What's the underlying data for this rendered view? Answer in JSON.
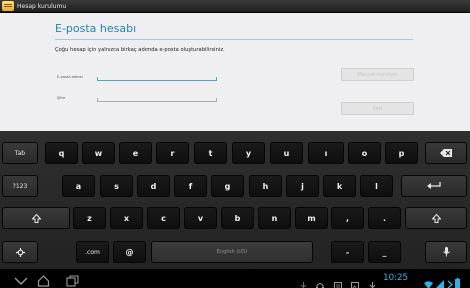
{
  "app": {
    "title": "Hesap kurulumu",
    "icon": "account-setup-icon"
  },
  "form": {
    "heading": "E-posta hesabı",
    "description": "Çoğu hesap için yalnızca birkaç adımda e-posta oluşturabilirsiniz.",
    "email_label": "E-posta adresi",
    "email_value": "",
    "password_label": "Şifre",
    "password_value": "",
    "manual_setup_label": "Manuel kurulum",
    "next_label": "İleri"
  },
  "keyboard": {
    "row1": [
      "Tab",
      "q",
      "w",
      "e",
      "r",
      "t",
      "y",
      "u",
      "ı",
      "o",
      "p",
      "⌫"
    ],
    "row2": [
      "?123",
      "a",
      "s",
      "d",
      "f",
      "g",
      "h",
      "j",
      "k",
      "l",
      "↵"
    ],
    "row3": [
      "⇧",
      "z",
      "x",
      "c",
      "v",
      "b",
      "n",
      "m",
      ",",
      ".",
      "⇧"
    ],
    "row4": [
      "⚙",
      ".com",
      "@",
      "English (US)",
      "-",
      "_",
      "🎤"
    ],
    "space_label": "English (US)",
    "com_label": ".com",
    "accent_color": "#2fb3e3"
  },
  "navbar": {
    "buttons": [
      "back-icon",
      "home-icon",
      "recent-apps-icon"
    ],
    "status_icons": [
      "usb-icon",
      "headset-icon",
      "sync-icon",
      "screenshot-icon",
      "download-icon"
    ],
    "clock": "10:25"
  }
}
